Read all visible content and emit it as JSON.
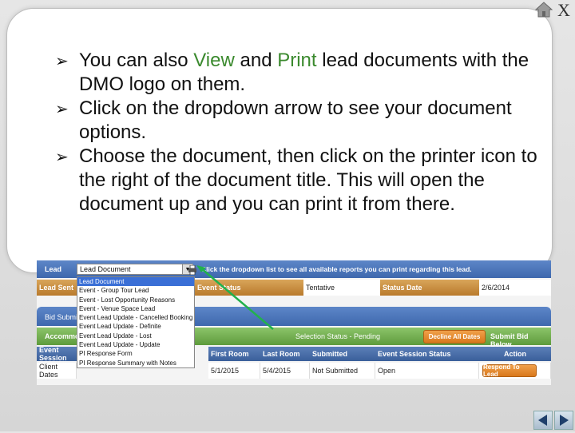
{
  "slide": {
    "bullets": [
      {
        "pre": "You can also ",
        "hl1": "View",
        "mid": " and ",
        "hl2": "Print",
        "post": " lead documents with the DMO logo on them."
      },
      {
        "text": "Click on the dropdown arrow to see your document options."
      },
      {
        "text": "Choose the document, then click on the printer icon to the right of the document title. This will open the document up and you can print it from there."
      }
    ],
    "close_label": "X",
    "highlight_color": "#3b8a2e"
  },
  "screenshot": {
    "lead_label": "Lead",
    "selected_document": "Lead Document",
    "instruction": "Click the dropdown list to see all available reports you can print regarding this lead.",
    "lead_sent_label": "Lead Sent",
    "event_status_label": "Event Status",
    "event_status_value": "Tentative",
    "status_date_label": "Status Date",
    "status_date_value": "2/6/2014",
    "bid_tab": "Bid Submis",
    "accommo_tab": "Accommoc",
    "selection_status": "Selection Status - Pending",
    "decline_button": "Decline All Dates",
    "submit_bid": "Submit Bid Below",
    "columns": [
      "Event Session",
      "First Room",
      "Last Room",
      "Submitted",
      "Event Session Status",
      "Action"
    ],
    "row": {
      "session": "Client Dates",
      "first_room": "5/1/2015",
      "last_room": "5/4/2015",
      "submitted": "Not Submitted",
      "status": "Open",
      "action": "Respond To Lead"
    },
    "dropdown_options": [
      "Lead Document",
      "Event - Group Tour Lead",
      "Event - Lost Opportunity Reasons",
      "Event - Venue Space Lead",
      "Event Lead Update - Cancelled Booking",
      "Event Lead Update - Definite",
      "Event Lead Update - Lost",
      "Event Lead Update - Update",
      "PI Response Form",
      "PI Response Summary with Notes"
    ]
  }
}
